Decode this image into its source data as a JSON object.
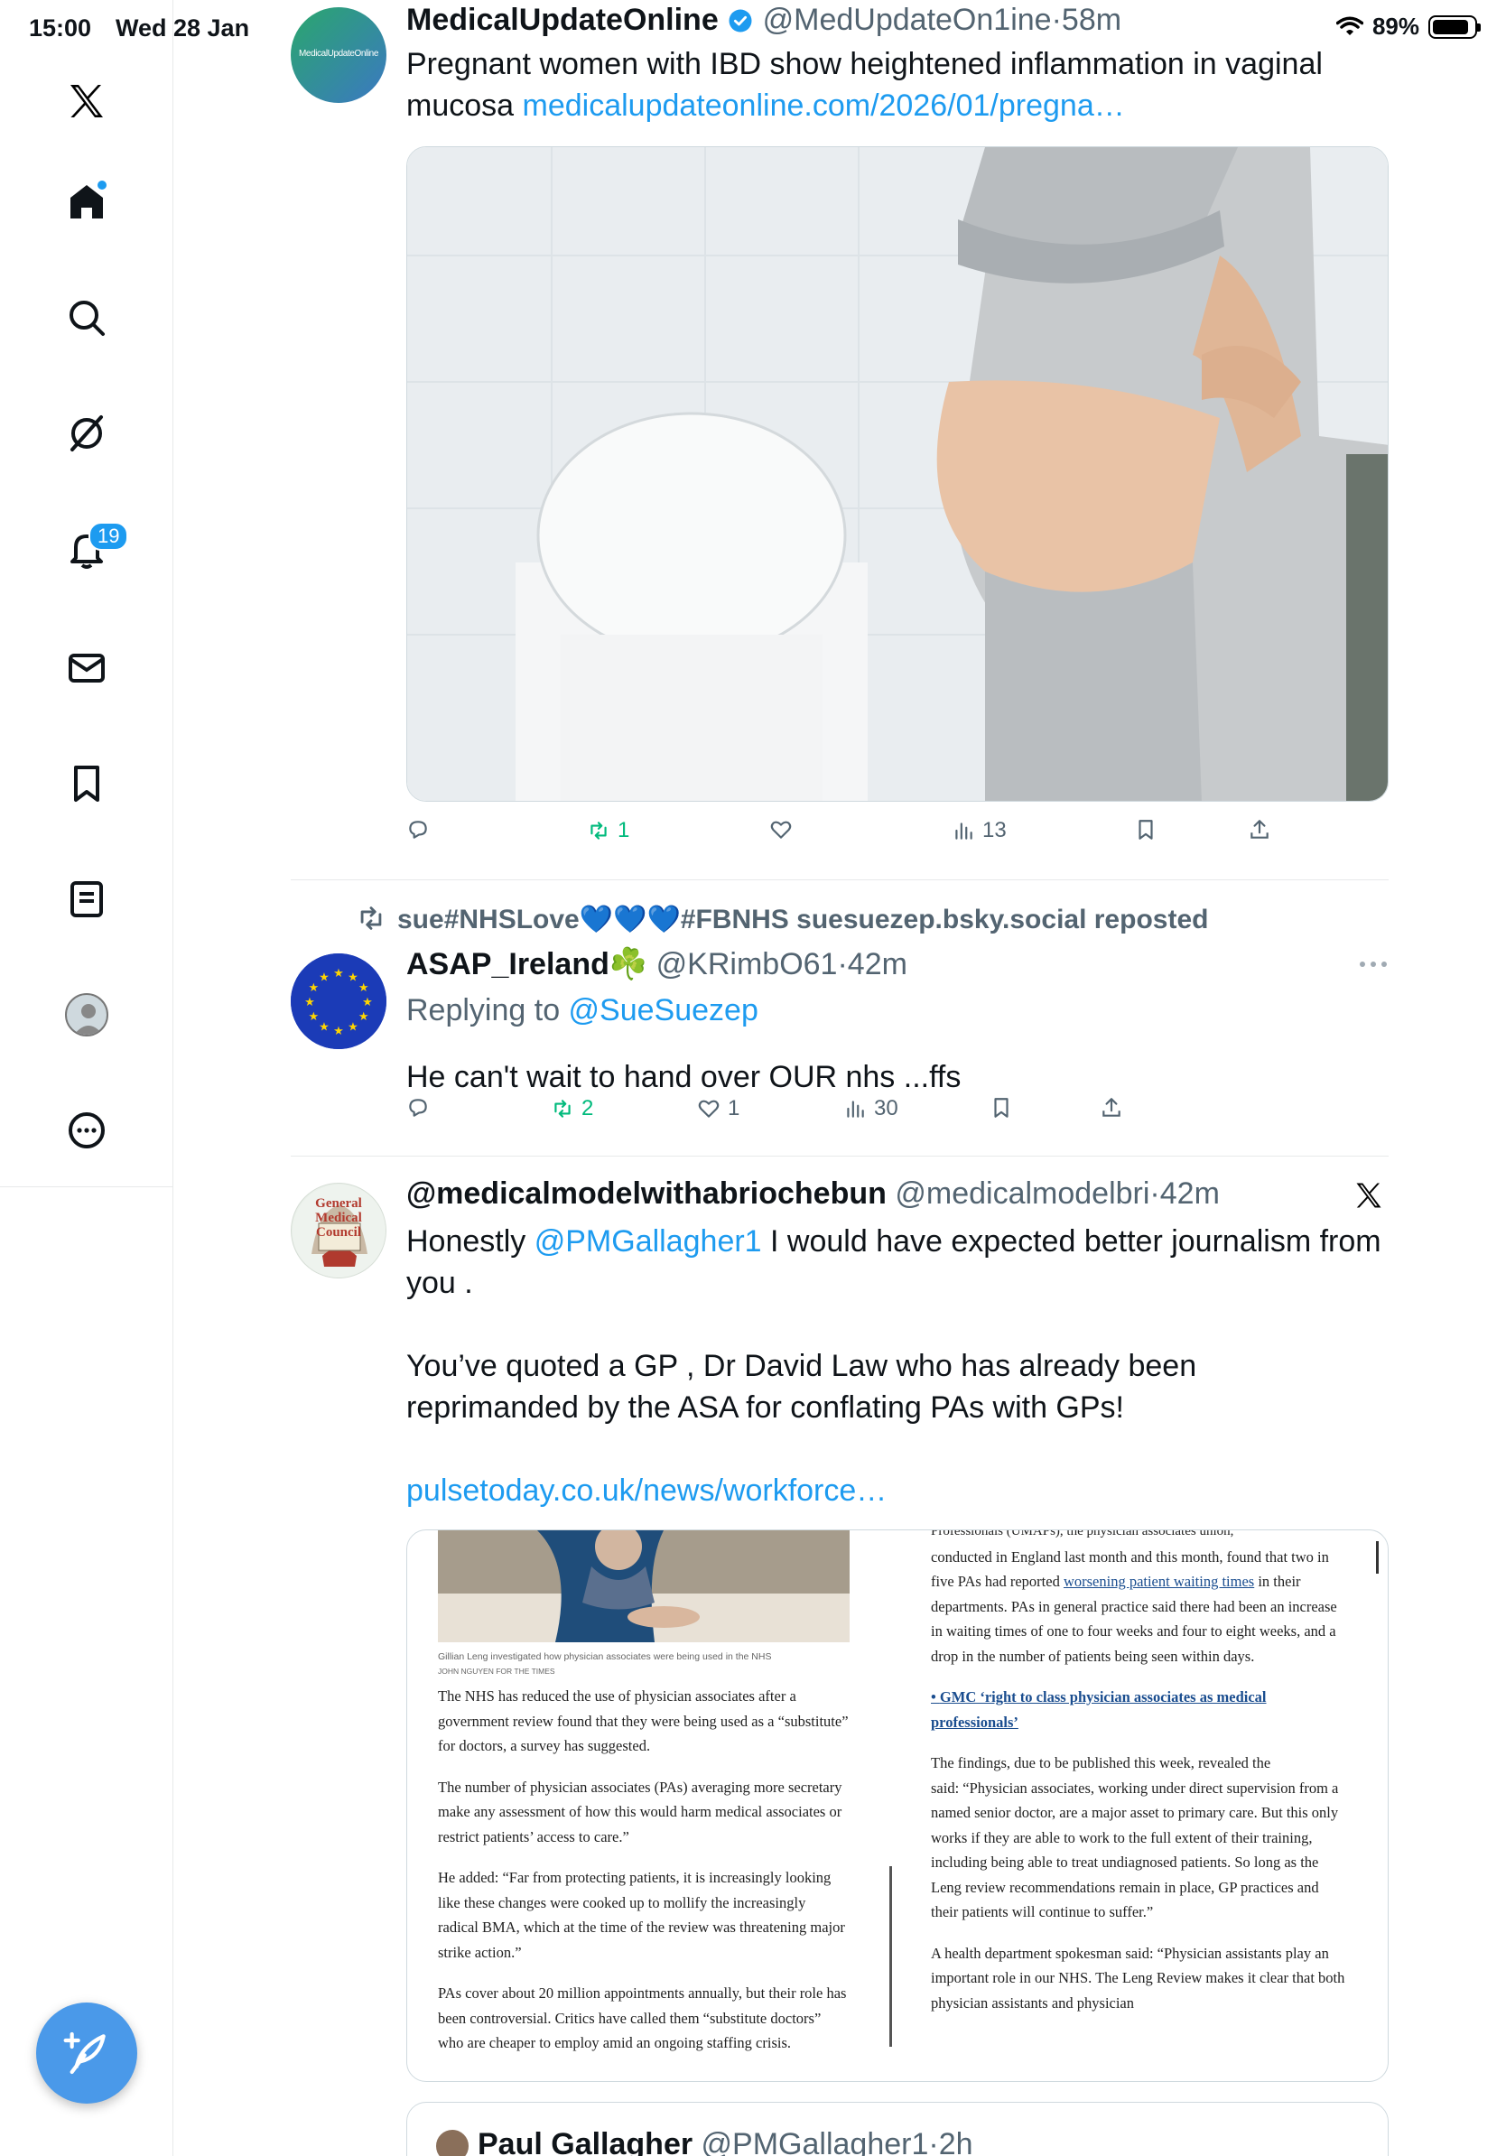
{
  "status_bar": {
    "time": "15:00",
    "date": "Wed 28 Jan",
    "battery": "89%"
  },
  "sidebar": {
    "items": [
      {
        "name": "home",
        "label": "Home"
      },
      {
        "name": "search",
        "label": "Search"
      },
      {
        "name": "grok",
        "label": "Grok"
      },
      {
        "name": "notifications",
        "label": "Notifications",
        "badge": "19"
      },
      {
        "name": "messages",
        "label": "Messages"
      },
      {
        "name": "bookmarks",
        "label": "Bookmarks"
      },
      {
        "name": "lists",
        "label": "Lists"
      },
      {
        "name": "profile",
        "label": "Profile"
      },
      {
        "name": "more",
        "label": "More"
      }
    ]
  },
  "tweets": [
    {
      "display_name": "MedicalUpdateOnline",
      "handle": "@MedUpdateOn1ine",
      "time": "58m",
      "avatar_text": "MedicalUpdateOnline",
      "text": "Pregnant women with IBD show heightened inflammation in vaginal mucosa ",
      "link": "medicalupdateonline.com/2026/01/pregna…",
      "stats": {
        "replies": "",
        "reposts": "1",
        "likes": "",
        "views": "13"
      }
    },
    {
      "repost_by": "sue#NHSLove💙💙💙#FBNHS suesuezep.bsky.social reposted",
      "display_name": "ASAP_Ireland",
      "name_emoji": "☘️",
      "handle": "@KRimbO61",
      "time": "42m",
      "replying_prefix": "Replying to ",
      "replying_to": "@SueSuezep",
      "text": "He can't wait to hand over OUR nhs  ...ffs",
      "stats": {
        "replies": "",
        "reposts": "2",
        "likes": "1",
        "views": "30"
      }
    },
    {
      "display_name": "@medicalmodelwithabriochebun",
      "handle": "@medicalmodelbri",
      "time": "42m",
      "avatar_text": [
        "General",
        "Medical",
        "Council"
      ],
      "text_1": "Honestly ",
      "mention": "@PMGallagher1",
      "text_2": " I would have expected better journalism from you .",
      "text_3": "You’ve quoted a GP , Dr David Law who has already been reprimanded by the ASA for conflating PAs with GPs!",
      "link": "pulsetoday.co.uk/news/workforce…",
      "article": {
        "caption": "Gillian Leng investigated how physician associates were being used in the NHS",
        "credit": "JOHN NGUYEN FOR THE TIMES",
        "left_p1": "The NHS has reduced the use of physician associates after a government review found that they were being used as a “substitute” for doctors, a survey has suggested.",
        "left_p2": "The number of physician associates (PAs) averaging more secretary make any assessment of how this would harm medical associates or restrict patients’ access to care.”",
        "left_p3": "He added: “Far from protecting patients, it is increasingly looking like these changes were cooked up to mollify the increasingly radical BMA, which at the time of the review was threatening major strike action.”",
        "left_p4": "PAs cover about 20 million appointments annually, but their role has been controversial. Critics have called them “substitute doctors” who are cheaper to employ amid an ongoing staffing crisis.",
        "right_top": "Professionals (UMAPs), the physician associates union,",
        "right_p1a": "conducted in England last month and this month, found that two in five PAs had reported ",
        "right_p1_link": "worsening patient waiting times",
        "right_p1b": " in their departments. PAs in general practice said there had been an increase in waiting times of one to four weeks and four to eight weeks, and a drop in the number of patients being seen within days.",
        "right_bullet": "• ",
        "right_bullet_link": "GMC ‘right to class physician associates as medical professionals’",
        "right_p2": "The findings, due to be published this week, revealed the",
        "right_p3": "said: “Physician associates, working under direct supervision from a named senior doctor, are a major asset to primary care. But this only works if they are able to work to the full extent of their training, including being able to treat undiagnosed patients. So long as the Leng review recommendations remain in place, GP practices and their patients will continue to suffer.”",
        "right_p4": "A health department spokesman said: “Physician assistants play an important role in our NHS. The Leng Review makes it clear that both physician assistants and physician"
      },
      "quote": {
        "display_name": "Paul Gallagher",
        "handle": "@PMGallagher1",
        "time": "2h"
      }
    }
  ],
  "separator_dot": "·",
  "colors": {
    "accent": "#1d9bf0",
    "repost": "#00ba7c",
    "muted": "#536471"
  }
}
